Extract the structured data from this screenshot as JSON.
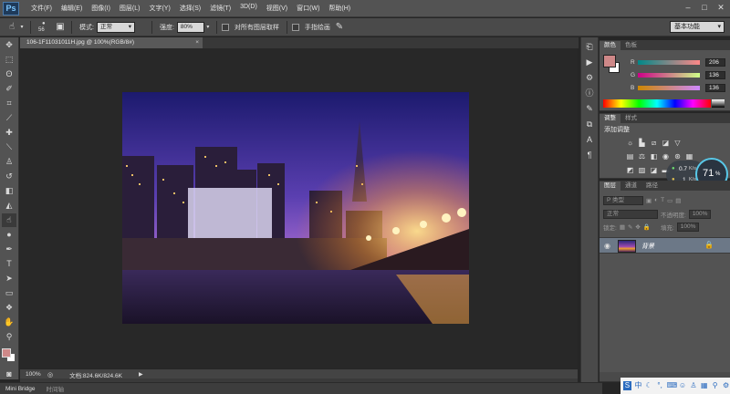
{
  "app": {
    "logo": "Ps"
  },
  "menu": [
    "文件(F)",
    "编辑(E)",
    "图像(I)",
    "图层(L)",
    "文字(Y)",
    "选择(S)",
    "滤镜(T)",
    "3D(D)",
    "视图(V)",
    "窗口(W)",
    "帮助(H)"
  ],
  "options": {
    "brush_size": "56",
    "mode_label": "模式:",
    "mode_value": "正常",
    "strength_label": "强度:",
    "strength_value": "80%",
    "sample_all_label": "对所有图层取样",
    "finger_paint_label": "手指绘画",
    "workspace": "基本功能"
  },
  "document": {
    "tab_title": "106-1F11031011H.jpg @ 100%(RGB/8#)",
    "tab_close": "×"
  },
  "status": {
    "zoom": "100%",
    "doc_size": "文档:824.6K/824.6K"
  },
  "bottom_tabs": [
    "Mini Bridge",
    "时间轴"
  ],
  "color_panel": {
    "tabs": [
      "颜色",
      "色板"
    ],
    "channels": [
      {
        "label": "R",
        "value": "206"
      },
      {
        "label": "G",
        "value": "136"
      },
      {
        "label": "B",
        "value": "136"
      }
    ],
    "foreground": "#ce8888",
    "background": "#ffffff"
  },
  "adjustments_panel": {
    "tabs": [
      "调整",
      "样式"
    ],
    "title": "添加调整"
  },
  "network_widget": {
    "percent": "71",
    "percent_sign": "%",
    "up": "0.7",
    "down": "1",
    "unit": "K/s"
  },
  "layers_panel": {
    "tabs": [
      "图层",
      "通道",
      "路径"
    ],
    "filter": "P 类型",
    "blend_mode": "正常",
    "opacity_label": "不透明度:",
    "opacity": "100%",
    "lock_label": "锁定:",
    "fill_label": "填充:",
    "fill": "100%",
    "layer_name": "背景"
  },
  "taskbar_icon_names": [
    "app-s-icon",
    "ime-zh-icon",
    "moon-icon",
    "punct-icon",
    "keyboard-icon",
    "user-icon",
    "shirt-icon",
    "grid-icon",
    "search-icon",
    "gear-icon"
  ]
}
